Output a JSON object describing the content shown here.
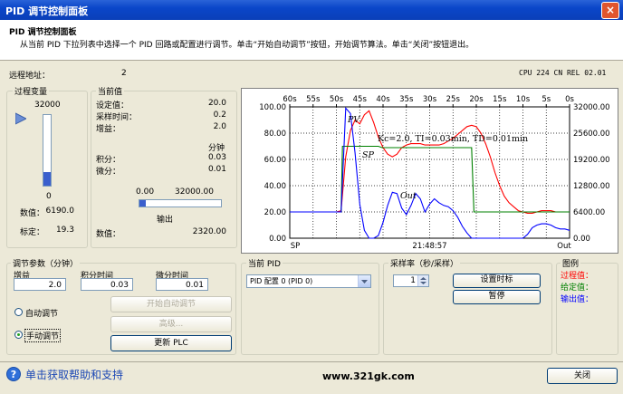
{
  "window": {
    "title": "PID 调节控制面板",
    "close_glyph": "×"
  },
  "header": {
    "title": "PID 调节控制面板",
    "description": "从当前 PID 下拉列表中选择一个 PID 回路或配置进行调节。单击“开始自动调节”按钮，开始调节算法。单击“关闭”按钮退出。"
  },
  "remote": {
    "label": "远程地址：",
    "value": "2",
    "cpu": "CPU 224 CN REL 02.01"
  },
  "process_var": {
    "group_label": "过程变量",
    "scale_max": "32000",
    "scale_min": "0",
    "value_label": "数值：",
    "value": "6190.0",
    "scale_label": "标定：",
    "scale": "19.3",
    "level_fraction": 0.193
  },
  "current": {
    "group_label": "当前值",
    "setpoint_label": "设定值：",
    "setpoint": "20.0",
    "sample_label": "采样时间：",
    "sample": "0.2",
    "gain_label": "增益：",
    "gain": "2.0",
    "unit_label": "分钟",
    "integral_label": "积分：",
    "integral": "0.03",
    "derivative_label": "微分：",
    "derivative": "0.01",
    "out_min": "0.00",
    "out_max": "32000.00",
    "output_label": "输出",
    "output_value_label": "数值：",
    "output_value": "2320.00",
    "output_fraction": 0.0725
  },
  "tuning": {
    "group_label": "调节参数（分钟）",
    "gain_label": "增益",
    "gain": "2.0",
    "integral_label": "积分时间",
    "integral": "0.03",
    "derivative_label": "微分时间",
    "derivative": "0.01",
    "auto_label": "自动调节",
    "manual_label": "手动调节",
    "start_auto_label": "开始自动调节",
    "advanced_label": "高级...",
    "update_label": "更新 PLC"
  },
  "current_pid": {
    "group_label": "当前 PID",
    "selected": "PID 配置 0 (PID 0)"
  },
  "sampling": {
    "group_label": "采样率（秒/采样）",
    "value": "1",
    "set_timebase_label": "设置时标",
    "pause_label": "暂停"
  },
  "legend": {
    "group_label": "图例",
    "pv_label": "过程值：",
    "sp_label": "给定值：",
    "out_label": "输出值：",
    "pv_color": "#ff0000",
    "sp_color": "#008000",
    "out_color": "#0000ff"
  },
  "footer": {
    "help_label": "单击获取帮助和支持",
    "watermark": "www.321gk.com",
    "close_label": "关闭"
  },
  "chart_data": {
    "type": "line",
    "x_ticks": [
      "60s",
      "55s",
      "50s",
      "45s",
      "40s",
      "35s",
      "30s",
      "25s",
      "20s",
      "15s",
      "10s",
      "5s",
      "0s"
    ],
    "x_seconds": [
      60,
      55,
      50,
      45,
      40,
      35,
      30,
      25,
      20,
      15,
      10,
      5,
      0
    ],
    "yleft_ticks": [
      "100.00",
      "80.00",
      "60.00",
      "40.00",
      "20.00",
      "0.00"
    ],
    "yright_ticks": [
      "32000.00",
      "25600.00",
      "19200.00",
      "12800.00",
      "6400.00",
      "0.00"
    ],
    "ylim_left": [
      0,
      100
    ],
    "ylim_right": [
      0,
      32000
    ],
    "bottom_left_label": "SP",
    "bottom_center_label": "21:48:57",
    "bottom_right_label": "Out",
    "annotation_formula": "Kc=2.0, TI=0.03min, TD=0.01min",
    "annotation_pv": "PV",
    "annotation_sp": "SP",
    "annotation_out": "Out",
    "grid": true,
    "series": [
      {
        "name": "PV",
        "color": "#ff0000",
        "points": [
          [
            60,
            20
          ],
          [
            50,
            20
          ],
          [
            49,
            21
          ],
          [
            48,
            62
          ],
          [
            47,
            82
          ],
          [
            46,
            90
          ],
          [
            45,
            87
          ],
          [
            44,
            94
          ],
          [
            43,
            97
          ],
          [
            42,
            88
          ],
          [
            41,
            77
          ],
          [
            40,
            69
          ],
          [
            39,
            64
          ],
          [
            38,
            62
          ],
          [
            37,
            64
          ],
          [
            36,
            69
          ],
          [
            35,
            71
          ],
          [
            34,
            72
          ],
          [
            33,
            72
          ],
          [
            32,
            72
          ],
          [
            31,
            71
          ],
          [
            30,
            71
          ],
          [
            29,
            71
          ],
          [
            28,
            71
          ],
          [
            27,
            72
          ],
          [
            26,
            74
          ],
          [
            25,
            76
          ],
          [
            24,
            79
          ],
          [
            23,
            82
          ],
          [
            22,
            85
          ],
          [
            21,
            86
          ],
          [
            20,
            85
          ],
          [
            19,
            80
          ],
          [
            18,
            72
          ],
          [
            17,
            62
          ],
          [
            16,
            50
          ],
          [
            15,
            40
          ],
          [
            14,
            32
          ],
          [
            13,
            27
          ],
          [
            12,
            24
          ],
          [
            11,
            21
          ],
          [
            10,
            20
          ],
          [
            9,
            19
          ],
          [
            8,
            19
          ],
          [
            7,
            20
          ],
          [
            6,
            21
          ],
          [
            5,
            21
          ],
          [
            4,
            21
          ],
          [
            3,
            20
          ],
          [
            2,
            20
          ],
          [
            1,
            20
          ],
          [
            0,
            20
          ]
        ]
      },
      {
        "name": "SP",
        "color": "#008000",
        "points": [
          [
            60,
            20
          ],
          [
            49,
            20
          ],
          [
            48.7,
            70
          ],
          [
            41,
            70
          ],
          [
            40.2,
            69
          ],
          [
            35,
            69
          ],
          [
            21,
            69
          ],
          [
            20.5,
            20
          ],
          [
            0,
            20
          ]
        ]
      },
      {
        "name": "Out",
        "color": "#0000ff",
        "points": [
          [
            60,
            20
          ],
          [
            49,
            20
          ],
          [
            48,
            99
          ],
          [
            47,
            95
          ],
          [
            46,
            65
          ],
          [
            45,
            26
          ],
          [
            44,
            6
          ],
          [
            43,
            0
          ],
          [
            42,
            0
          ],
          [
            41,
            2
          ],
          [
            40,
            12
          ],
          [
            39,
            25
          ],
          [
            38,
            35
          ],
          [
            37,
            34
          ],
          [
            36,
            23
          ],
          [
            35,
            18
          ],
          [
            34,
            25
          ],
          [
            33,
            34
          ],
          [
            32,
            30
          ],
          [
            31,
            20
          ],
          [
            30,
            26
          ],
          [
            29,
            30
          ],
          [
            28,
            27
          ],
          [
            27,
            25
          ],
          [
            26,
            24
          ],
          [
            25,
            21
          ],
          [
            24,
            16
          ],
          [
            23,
            9
          ],
          [
            22,
            4
          ],
          [
            21,
            0
          ],
          [
            20,
            0
          ],
          [
            19,
            0
          ],
          [
            18,
            0
          ],
          [
            17,
            0
          ],
          [
            16,
            0
          ],
          [
            15,
            0
          ],
          [
            14,
            0
          ],
          [
            13,
            0
          ],
          [
            12,
            0
          ],
          [
            11,
            0
          ],
          [
            10,
            0
          ],
          [
            9,
            3
          ],
          [
            8,
            8
          ],
          [
            7,
            10
          ],
          [
            6,
            11
          ],
          [
            5,
            11
          ],
          [
            4,
            10
          ],
          [
            3,
            8
          ],
          [
            2,
            7
          ],
          [
            1,
            7
          ],
          [
            0,
            6
          ]
        ]
      }
    ]
  }
}
